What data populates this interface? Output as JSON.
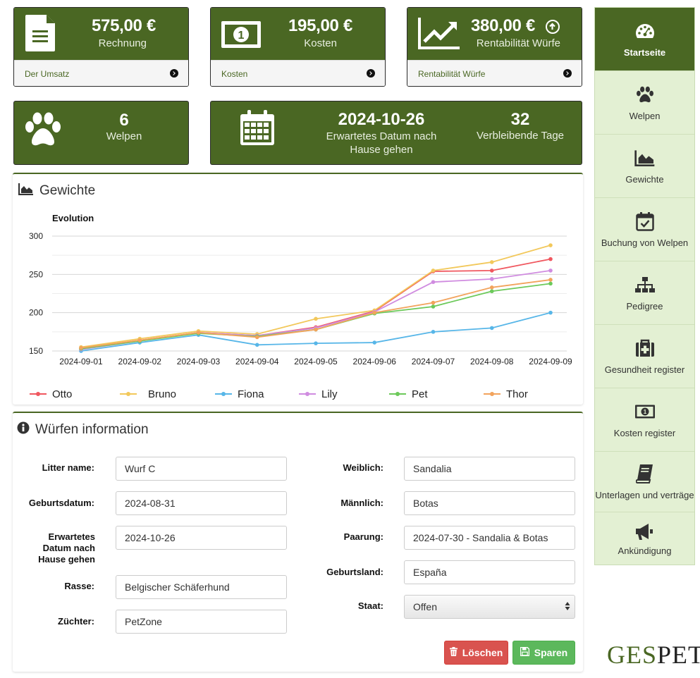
{
  "cards": {
    "invoice": {
      "value": "575,00 €",
      "label": "Rechnung",
      "link": "Der Umsatz"
    },
    "costs": {
      "value": "195,00 €",
      "label": "Kosten",
      "link": "Kosten"
    },
    "profit": {
      "value": "380,00 €",
      "label": "Rentabilität Würfe",
      "link": "Rentabilität Würfe"
    },
    "puppies": {
      "value": "6",
      "label": "Welpen"
    },
    "date": {
      "value": "2024-10-26",
      "label": "Erwartetes Datum nach Hause gehen",
      "days_value": "32",
      "days_label": "Verbleibende Tage"
    }
  },
  "weights_panel": {
    "title": "Gewichte"
  },
  "chart_data": {
    "type": "line",
    "title": "Evolution",
    "x": [
      "2024-09-01",
      "2024-09-02",
      "2024-09-03",
      "2024-09-04",
      "2024-09-05",
      "2024-09-06",
      "2024-09-07",
      "2024-09-08",
      "2024-09-09"
    ],
    "ylim": [
      150,
      300
    ],
    "yticks": [
      150,
      200,
      250,
      300
    ],
    "grid": true,
    "legend": "bottom",
    "series": [
      {
        "name": "Otto",
        "color": "#f0575f",
        "values": [
          153,
          164,
          174,
          170,
          181,
          202,
          254,
          255,
          270
        ]
      },
      {
        "name": "Bruno",
        "color": "#f2c85b",
        "values": [
          155,
          166,
          176,
          172,
          192,
          203,
          255,
          266,
          288
        ]
      },
      {
        "name": "Fiona",
        "color": "#57b6e8",
        "values": [
          150,
          161,
          171,
          158,
          160,
          161,
          175,
          180,
          200
        ]
      },
      {
        "name": "Lily",
        "color": "#d08ce0",
        "values": [
          152,
          163,
          174,
          170,
          180,
          201,
          240,
          244,
          255
        ]
      },
      {
        "name": "Pet",
        "color": "#6cc95a",
        "values": [
          153,
          163,
          173,
          169,
          178,
          199,
          208,
          228,
          238
        ]
      },
      {
        "name": "Thor",
        "color": "#f2a35c",
        "values": [
          154,
          164,
          174,
          168,
          178,
          200,
          213,
          233,
          243
        ]
      }
    ]
  },
  "info_panel": {
    "title": "Würfen information"
  },
  "form": {
    "litter_name": {
      "label": "Litter name:",
      "value": "Wurf C"
    },
    "birth_date": {
      "label": "Geburtsdatum:",
      "value": "2024-08-31"
    },
    "expected_date": {
      "label": "Erwartetes Datum nach Hause gehen",
      "value": "2024-10-26"
    },
    "breed": {
      "label": "Rasse:",
      "value": "Belgischer Schäferhund"
    },
    "breeder": {
      "label": "Züchter:",
      "value": "PetZone"
    },
    "female": {
      "label": "Weiblich:",
      "value": "Sandalia"
    },
    "male": {
      "label": "Männlich:",
      "value": "Botas"
    },
    "mating": {
      "label": "Paarung:",
      "value": "2024-07-30 - Sandalia & Botas"
    },
    "birth_country": {
      "label": "Geburtsland:",
      "value": "España"
    },
    "state": {
      "label": "Staat:",
      "value": "Offen"
    },
    "delete_label": "Löschen",
    "save_label": "Sparen"
  },
  "sidebar": {
    "items": [
      {
        "label": "Startseite",
        "icon": "dashboard-icon"
      },
      {
        "label": "Welpen",
        "icon": "paw-icon"
      },
      {
        "label": "Gewichte",
        "icon": "area-chart-icon"
      },
      {
        "label": "Buchung von Welpen",
        "icon": "calendar-check-icon"
      },
      {
        "label": "Pedigree",
        "icon": "sitemap-icon"
      },
      {
        "label": "Gesundheit register",
        "icon": "medkit-icon"
      },
      {
        "label": "Kosten register",
        "icon": "money-icon"
      },
      {
        "label": "Unterlagen und verträge",
        "icon": "book-icon"
      },
      {
        "label": "Ankündigung",
        "icon": "bullhorn-icon"
      }
    ]
  },
  "logo": {
    "part1": "GES",
    "part2": "PET",
    "color1": "#4a6723",
    "color2": "#222222"
  }
}
